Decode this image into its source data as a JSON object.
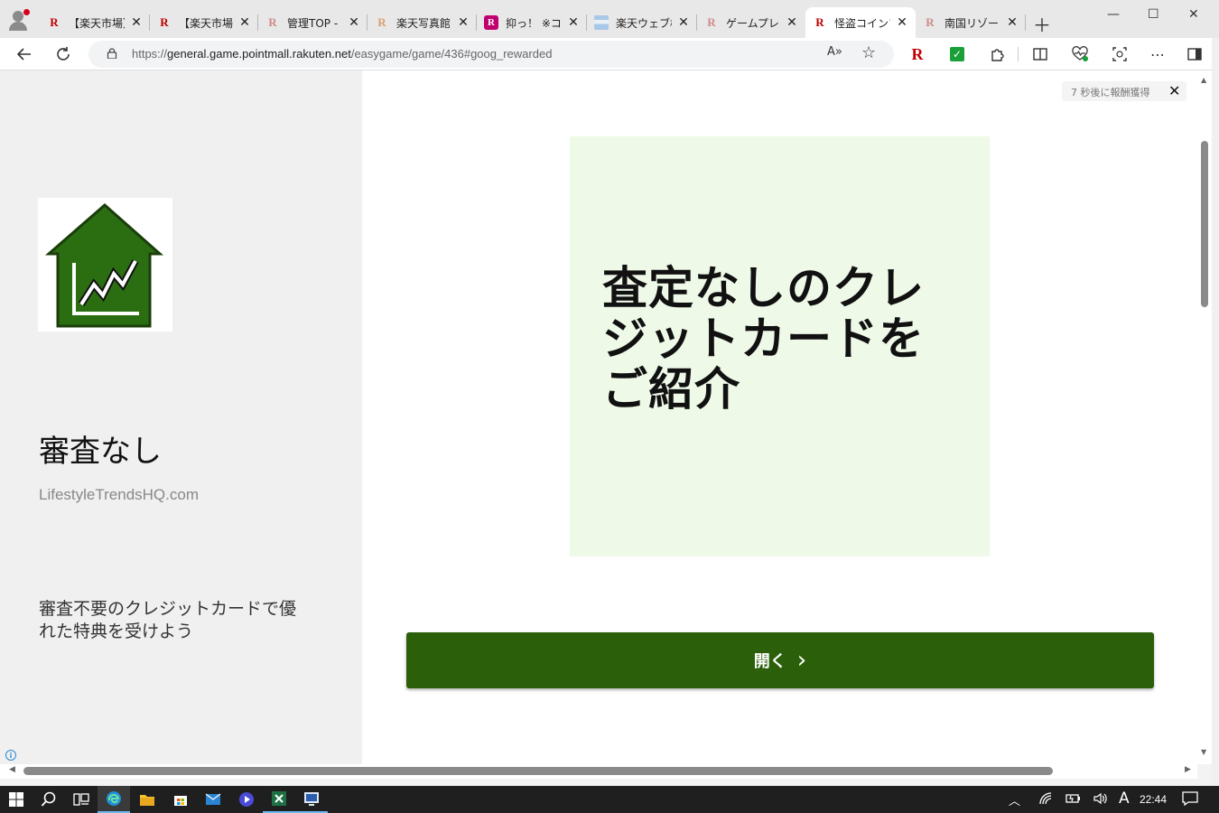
{
  "browser": {
    "tabs": [
      {
        "title": "【楽天市場】",
        "favicon": "rakuten-r-icon"
      },
      {
        "title": "【楽天市場】",
        "favicon": "rakuten-r-icon"
      },
      {
        "title": "管理TOP -",
        "favicon": "rakuten-r-icon"
      },
      {
        "title": "楽天写真館",
        "favicon": "rakuten-r-icon"
      },
      {
        "title": "抑っ！ ※コ",
        "favicon": "rakuten-boxed-r-icon"
      },
      {
        "title": "楽天ウェブ検",
        "favicon": "striped-page-icon"
      },
      {
        "title": "ゲームプレイ",
        "favicon": "rakuten-r-icon"
      },
      {
        "title": "怪盗コインフ",
        "favicon": "rakuten-r-icon",
        "active": true
      },
      {
        "title": "南国リゾート",
        "favicon": "rakuten-r-icon"
      }
    ],
    "url": {
      "protocol": "https://",
      "host": "general.game.pointmall.rakuten.net",
      "path": "/easygame/game/436#goog_rewarded"
    },
    "extensions": [
      "rakuten-r-icon",
      "green-check-icon",
      "puzzle-icon",
      "split-screen-icon",
      "heart-pulse-icon",
      "screenshot-icon",
      "more-icon",
      "sidebar-icon"
    ]
  },
  "ad": {
    "title": "審査なし",
    "domain": "LifestyleTrendsHQ.com",
    "description": "審査不要のクレジットカードで優れた特典を受けよう",
    "creative_text": "査定なしのクレジットカードをご紹介",
    "open_label": "開く",
    "reward_notice": "7 秒後に報酬獲得",
    "logo_color": "#2b6e12",
    "button_color": "#2b5f0a",
    "creative_bg": "#eef9e8"
  },
  "taskbar": {
    "apps": [
      "windows-start-icon",
      "search-icon",
      "task-view-icon",
      "edge-icon",
      "file-explorer-icon",
      "store-icon",
      "mail-icon",
      "media-player-icon",
      "excel-icon",
      "remote-desktop-icon"
    ],
    "clock": "22:44",
    "ime": "A"
  }
}
